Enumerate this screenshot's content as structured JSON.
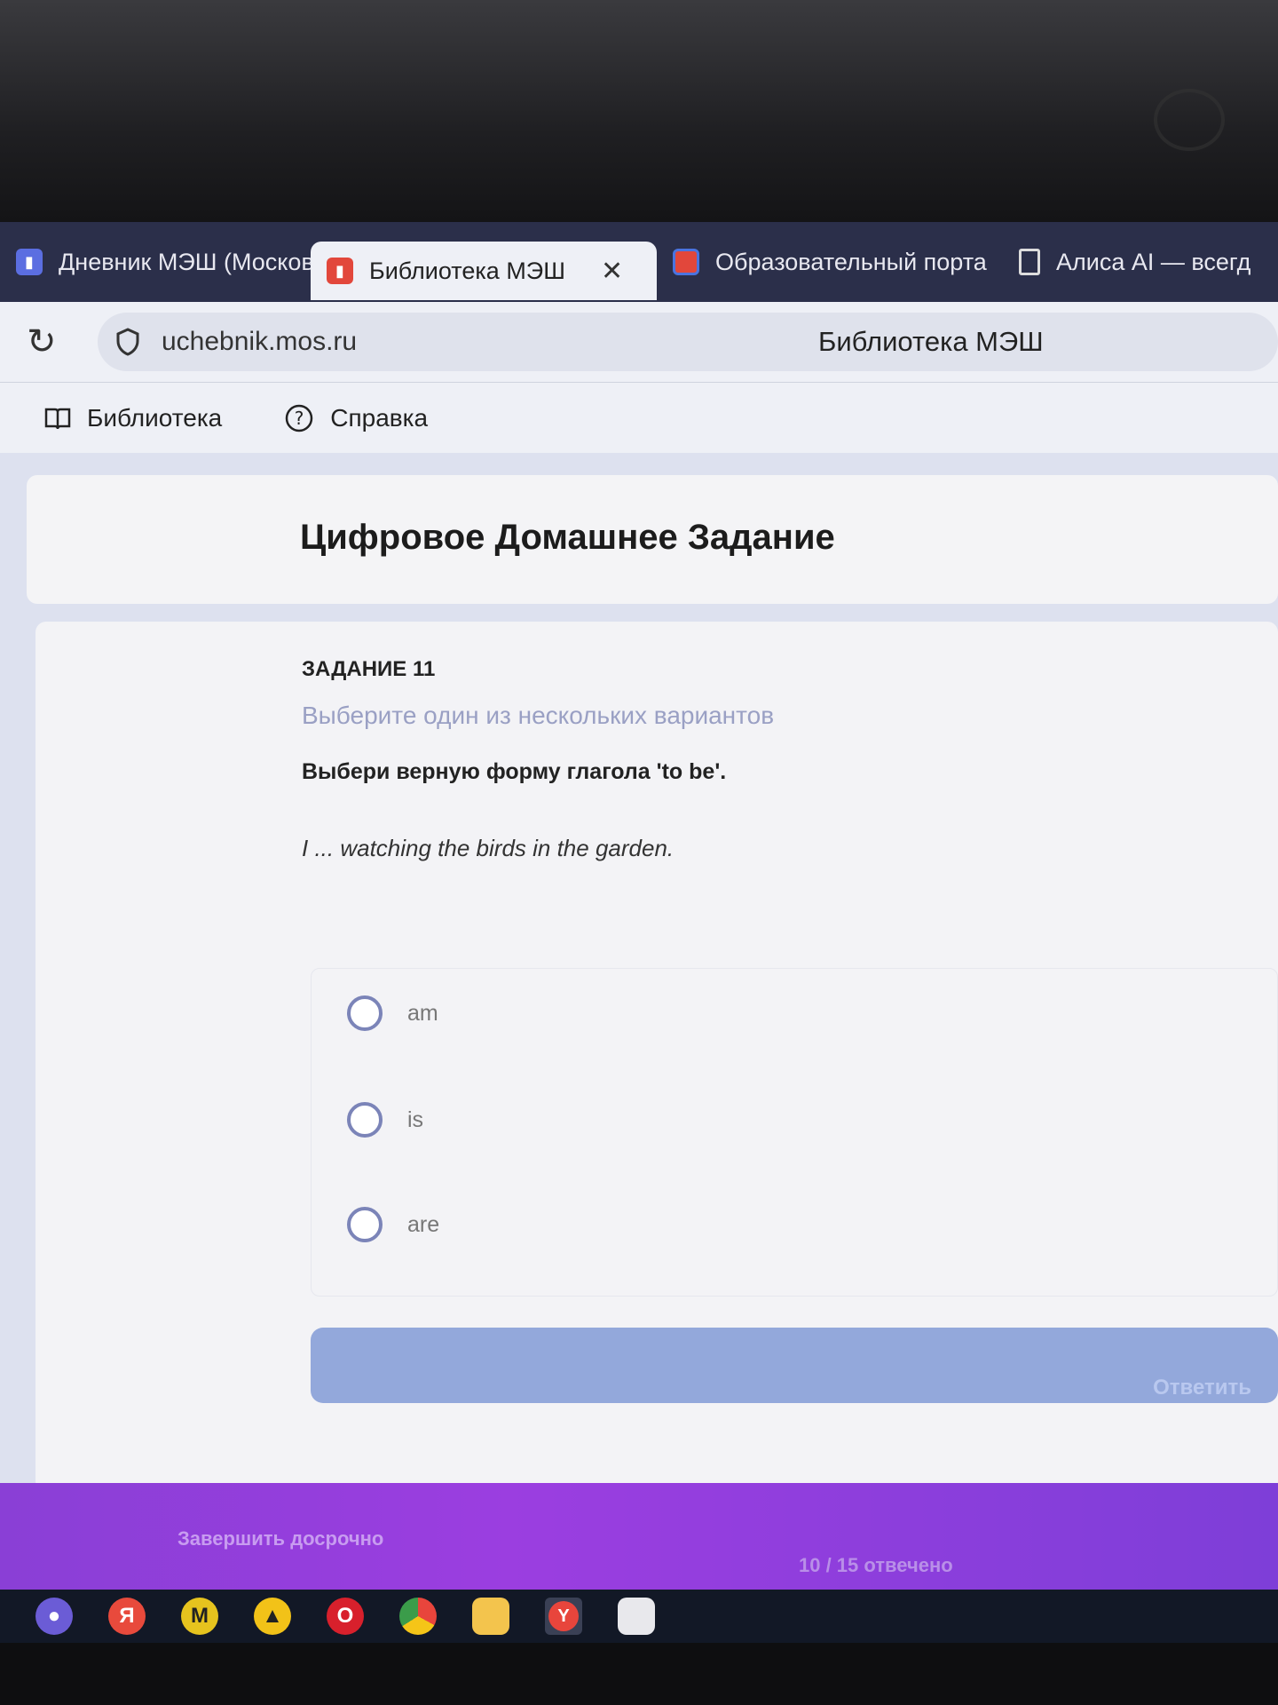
{
  "browser": {
    "tabs": [
      {
        "label": "Дневник МЭШ (Москов",
        "icon": "mesh-diary-icon",
        "active": false
      },
      {
        "label": "Библиотека МЭШ",
        "icon": "mesh-library-icon",
        "active": true,
        "close": "✕"
      },
      {
        "label": "Образовательный порта",
        "icon": "portal-icon",
        "active": false
      },
      {
        "label": "Алиса AI — всегд",
        "icon": "page-icon",
        "active": false
      }
    ],
    "address": {
      "url": "uchebnik.mos.ru",
      "page_title": "Библиотека МЭШ"
    },
    "bookmarks": [
      {
        "label": "Библиотека",
        "icon": "book-icon"
      },
      {
        "label": "Справка",
        "icon": "help-icon"
      }
    ]
  },
  "page": {
    "header_title": "Цифровое Домашнее Задание",
    "task": {
      "number": "ЗАДАНИЕ 11",
      "hint": "Выберите один из нескольких вариантов",
      "question": "Выбери верную форму глагола 'to be'.",
      "sentence": "I ... watching the birds in the garden.",
      "options": [
        "am",
        "is",
        "are"
      ],
      "answer_button": "Ответить"
    },
    "footer": {
      "finish_early": "Завершить досрочно",
      "progress": "10 / 15 отвечено"
    }
  },
  "taskbar": {
    "icons": [
      "search-icon",
      "yandex-icon",
      "app-icon",
      "drive-icon",
      "opera-icon",
      "chrome-icon",
      "folder-icon",
      "yandex-browser-icon",
      "notes-icon"
    ]
  },
  "colors": {
    "accent": "#8a3fd6",
    "button": "#93a8db",
    "hint": "#9aa0c4"
  }
}
